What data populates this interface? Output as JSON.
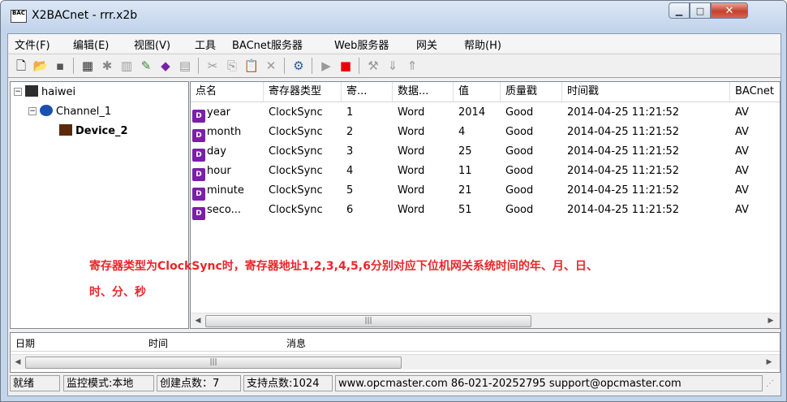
{
  "window": {
    "title": "X2BACnet - rrr.x2b",
    "icon_text": "BAC"
  },
  "menu": [
    "文件(F)",
    "编辑(E)",
    "视图(V)",
    "工具",
    "BACnet服务器",
    "Web服务器",
    "网关",
    "帮助(H)"
  ],
  "tree": {
    "root": "haiwei",
    "channel": "Channel_1",
    "device": "Device_2"
  },
  "table": {
    "columns": [
      "点名",
      "寄存器类型",
      "寄...",
      "数据...",
      "值",
      "质量戳",
      "时间戳",
      "BACnet"
    ],
    "rows": [
      [
        "year",
        "ClockSync",
        "1",
        "Word",
        "2014",
        "Good",
        "2014-04-25 11:21:52",
        "AV"
      ],
      [
        "month",
        "ClockSync",
        "2",
        "Word",
        "4",
        "Good",
        "2014-04-25 11:21:52",
        "AV"
      ],
      [
        "day",
        "ClockSync",
        "3",
        "Word",
        "25",
        "Good",
        "2014-04-25 11:21:52",
        "AV"
      ],
      [
        "hour",
        "ClockSync",
        "4",
        "Word",
        "11",
        "Good",
        "2014-04-25 11:21:52",
        "AV"
      ],
      [
        "minute",
        "ClockSync",
        "5",
        "Word",
        "21",
        "Good",
        "2014-04-25 11:21:52",
        "AV"
      ],
      [
        "seco...",
        "ClockSync",
        "6",
        "Word",
        "51",
        "Good",
        "2014-04-25 11:21:52",
        "AV"
      ]
    ]
  },
  "annotation": {
    "line1": "寄存器类型为ClockSync时，寄存器地址1,2,3,4,5,6分别对应下位机网关系统时间的年、月、日、",
    "line2": "时、分、秒",
    "color": "#e8272b"
  },
  "log": {
    "columns": [
      "日期",
      "时间",
      "消息"
    ]
  },
  "status": {
    "ready": "就绪",
    "mode": "监控模式:本地",
    "created": "创建点数：7",
    "supported": "支持点数:1024",
    "contact": "www.opcmaster.com 86-021-20252795 support@opcmaster.com"
  }
}
